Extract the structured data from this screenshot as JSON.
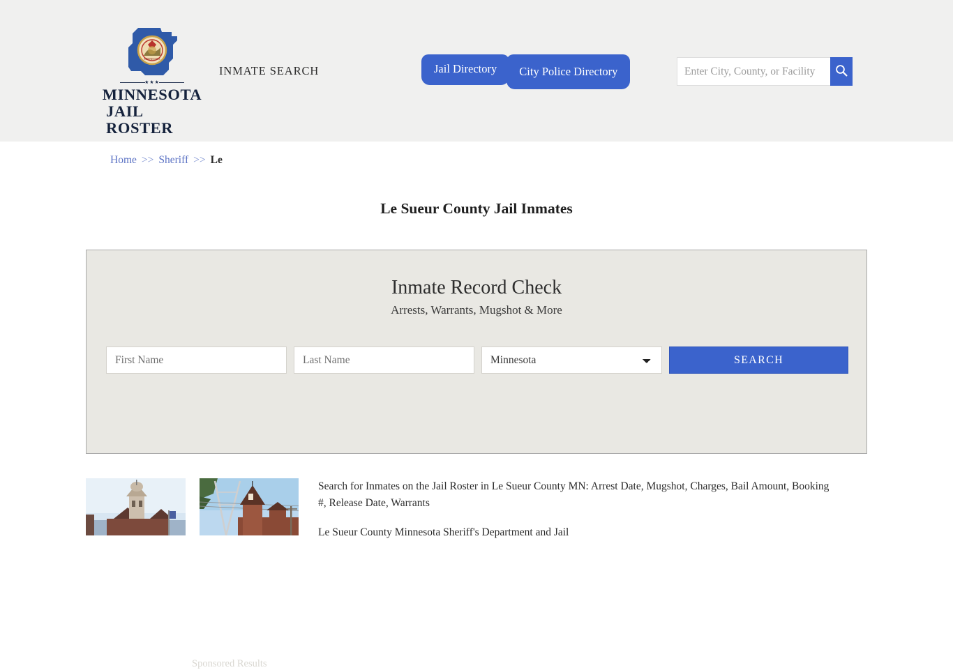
{
  "header": {
    "logo": {
      "icon": "minnesota-state-seal-icon",
      "line1": "MINNESOTA",
      "line2": "JAIL ROSTER",
      "dots": "★★★"
    },
    "tagline": "INMATE SEARCH",
    "nav": [
      {
        "label": "Jail Directory",
        "name": "nav-jail-directory"
      },
      {
        "label": "City Police Directory",
        "name": "nav-city-police-directory"
      }
    ],
    "search": {
      "placeholder": "Enter City, County, or Facility",
      "value": "",
      "button_icon": "search-icon"
    }
  },
  "breadcrumb": {
    "home": "Home",
    "sep1": ">>",
    "sheriff": "Sheriff",
    "sep2": ">>",
    "current": "Le"
  },
  "page": {
    "title": "Le Sueur County Jail Inmates"
  },
  "record_check": {
    "title": "Inmate Record Check",
    "subtitle": "Arrests, Warrants, Mugshot & More",
    "first_name_placeholder": "First Name",
    "first_name_value": "",
    "last_name_placeholder": "Last Name",
    "last_name_value": "",
    "state_selected": "Minnesota",
    "state_options": [
      "Minnesota"
    ],
    "search_button": "SEARCH",
    "sponsored_label": "Sponsored Results"
  },
  "content": {
    "photo1_alt": "le-sueur-county-courthouse-photo",
    "photo2_alt": "le-sueur-county-jail-tower-photo",
    "paragraph1": "Search for Inmates on the Jail Roster in Le Sueur County MN: Arrest Date, Mugshot, Charges, Bail Amount, Booking #, Release Date, Warrants",
    "paragraph2": "Le Sueur County Minnesota Sheriff's Department and Jail"
  },
  "colors": {
    "accent_blue": "#3b63cc",
    "header_bg": "#f0f0ef",
    "card_bg": "#e9e8e3",
    "link_blue": "#5b72c4"
  }
}
